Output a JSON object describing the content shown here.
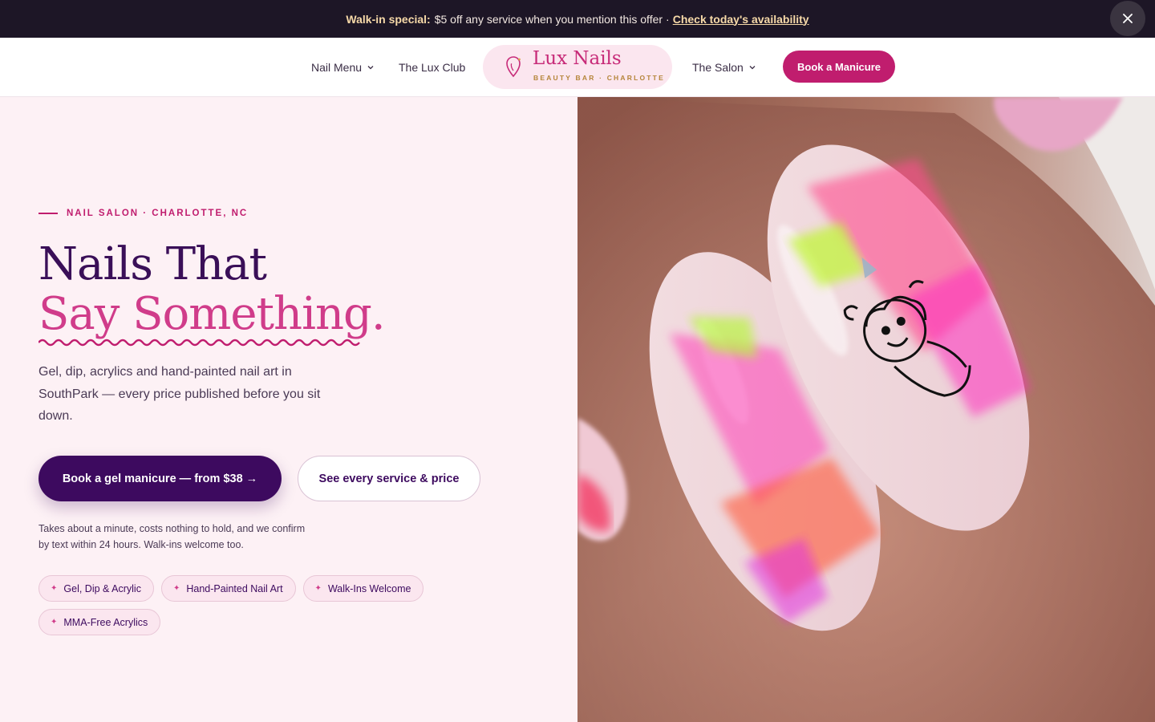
{
  "announcement": {
    "label": "Walk-in special:",
    "text": "$5 off any service when you mention this offer",
    "separator": "·",
    "link": "Check today's availability"
  },
  "nav": {
    "nail_menu": "Nail Menu",
    "lux_club": "The Lux Club",
    "salon": "The Salon",
    "book": "Book a Manicure"
  },
  "logo": {
    "name": "Lux Nails",
    "tagline": "BEAUTY BAR · CHARLOTTE"
  },
  "hero": {
    "eyebrow": "NAIL SALON · CHARLOTTE, NC",
    "title_line1": "Nails That",
    "title_line2": "Say Something.",
    "subtitle": "Gel, dip, acrylics and hand-painted nail art in SouthPark — every price published before you sit down.",
    "cta_primary": "Book a gel manicure — from $38 →",
    "cta_secondary": "See every service & price",
    "note": "Takes about a minute, costs nothing to hold, and we confirm by text within 24 hours. Walk-ins welcome too.",
    "chips": [
      "Gel, Dip & Acrylic",
      "Hand-Painted Nail Art",
      "Walk-Ins Welcome",
      "MMA-Free Acrylics"
    ]
  },
  "colors": {
    "brand": "#c01d6e",
    "deep_purple": "#3d0a5f",
    "announce_bg": "#1d1626",
    "page_bg": "#fdf1f5"
  },
  "icons": {
    "close": "close-icon",
    "chevron": "chevron-down-icon",
    "logo": "nail-pin-icon",
    "chip": "sparkle-icon"
  }
}
